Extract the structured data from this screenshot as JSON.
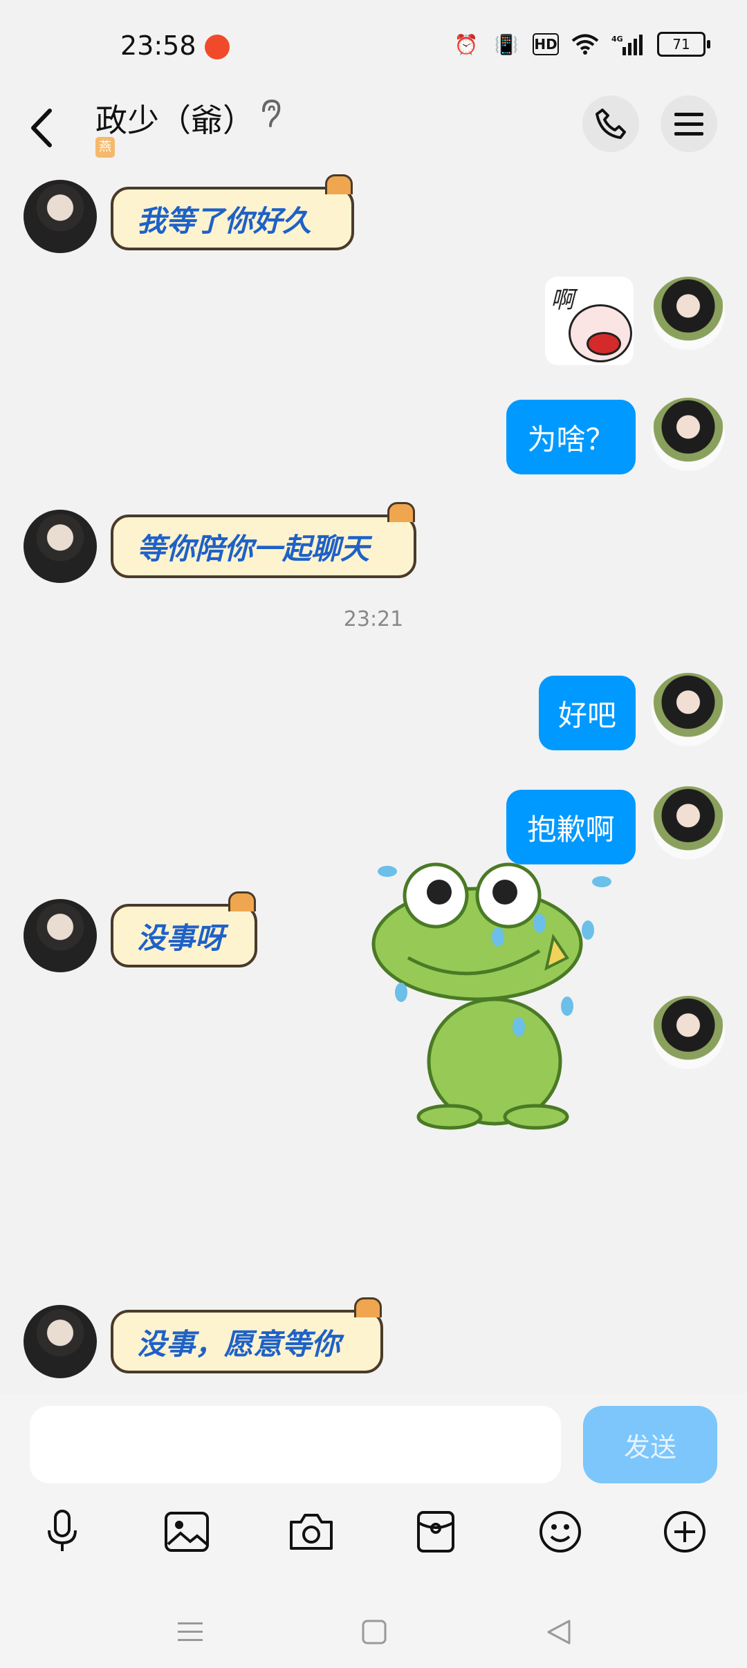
{
  "status_bar": {
    "time": "23:58",
    "battery": "71",
    "net": "4G",
    "hd": "HD"
  },
  "header": {
    "title": "政少（爺）",
    "sub_badge": "燕"
  },
  "messages": [
    {
      "side": "left",
      "kind": "text",
      "text": "我等了你好久"
    },
    {
      "side": "right",
      "kind": "sticker",
      "text": "啊"
    },
    {
      "side": "right",
      "kind": "text",
      "text": "为啥？"
    },
    {
      "side": "left",
      "kind": "text",
      "text": "等你陪你一起聊天"
    },
    {
      "kind": "time",
      "text": "23:21"
    },
    {
      "side": "right",
      "kind": "text",
      "text": "好吧"
    },
    {
      "side": "right",
      "kind": "text",
      "text": "抱歉啊"
    },
    {
      "side": "left",
      "kind": "text",
      "text": "没事呀"
    },
    {
      "side": "right",
      "kind": "sticker",
      "text": ""
    },
    {
      "side": "left",
      "kind": "text",
      "text": "没事，愿意等你"
    }
  ],
  "input": {
    "placeholder": "",
    "send_label": "发送"
  },
  "toolbar": {
    "icons": [
      "mic-icon",
      "image-icon",
      "camera-icon",
      "red-packet-icon",
      "emoji-icon",
      "plus-icon"
    ]
  },
  "colors": {
    "bubble_blue": "#0099ff",
    "cat_bubble_bg": "#fef3cf",
    "cat_text": "#1e61c7",
    "send_disabled": "#7cc6fb"
  }
}
